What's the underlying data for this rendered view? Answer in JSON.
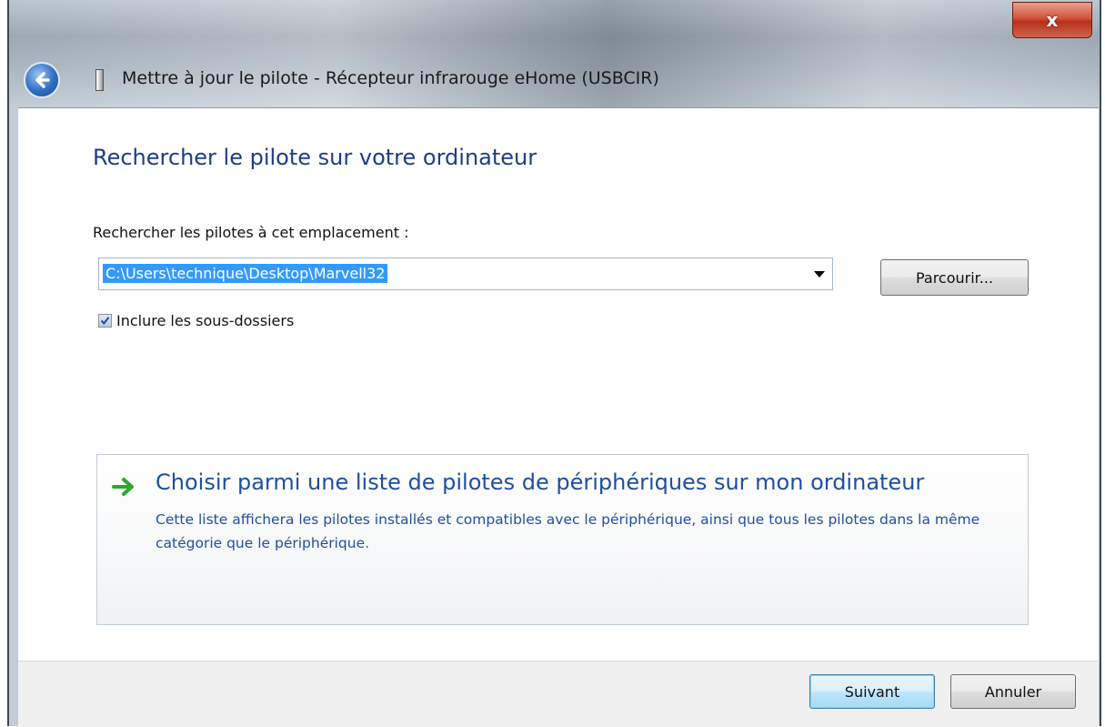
{
  "window": {
    "title": "Mettre à jour le pilote - Récepteur infrarouge eHome (USBCIR)",
    "close_label": "x"
  },
  "content": {
    "heading": "Rechercher le pilote sur votre ordinateur",
    "location_label": "Rechercher les pilotes à cet emplacement :",
    "location_value": "C:\\Users\\technique\\Desktop\\Marvell32",
    "browse_label": "Parcourir...",
    "include_subfolders_label": "Inclure les sous-dossiers",
    "include_subfolders_checked": true
  },
  "choice": {
    "title": "Choisir parmi une liste de pilotes de périphériques sur mon ordinateur",
    "description": "Cette liste affichera les pilotes installés et compatibles avec le périphérique, ainsi que tous les pilotes dans la même catégorie que le périphérique."
  },
  "footer": {
    "next_label": "Suivant",
    "cancel_label": "Annuler"
  },
  "colors": {
    "heading_blue": "#1e3c8b",
    "link_blue": "#1f4f9e",
    "selection_blue": "#3399ff",
    "close_red": "#c5412a",
    "arrow_green": "#2ea82e"
  }
}
